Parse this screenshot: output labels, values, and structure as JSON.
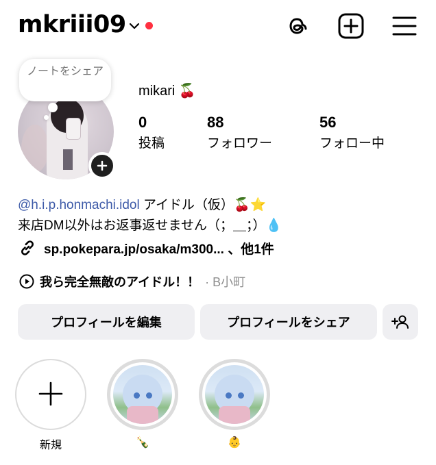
{
  "header": {
    "username": "mkriii09",
    "icons": [
      "chevron-down-icon",
      "threads-icon",
      "create-post-icon",
      "menu-icon"
    ],
    "notification_dot_color": "#ff3040"
  },
  "note": {
    "text": "ノートをシェア"
  },
  "profile": {
    "display_name": "mikari 🍒",
    "stats": [
      {
        "value": "0",
        "label": "投稿"
      },
      {
        "value": "88",
        "label": "フォロワー"
      },
      {
        "value": "56",
        "label": "フォロー中"
      }
    ]
  },
  "bio": {
    "mention": "@h.i.p.honmachi.idol",
    "line1_rest": " アイドル（仮）🍒⭐",
    "line2": "来店DM以外はお返事返せません（；＿；）💧",
    "link": "sp.pokepara.jp/osaka/m300... 、他1件",
    "music_title": "我ら完全無敵のアイドル！！",
    "music_artist": "· B小町"
  },
  "buttons": {
    "edit_profile": "プロフィールを編集",
    "share_profile": "プロフィールをシェア",
    "add_person_icon": "add-person-icon"
  },
  "highlights": [
    {
      "label": "新規",
      "type": "new"
    },
    {
      "label": "🍾",
      "type": "story"
    },
    {
      "label": "👶",
      "type": "story"
    }
  ],
  "colors": {
    "mention": "#3d5aa8",
    "button_bg": "#efeff2"
  }
}
